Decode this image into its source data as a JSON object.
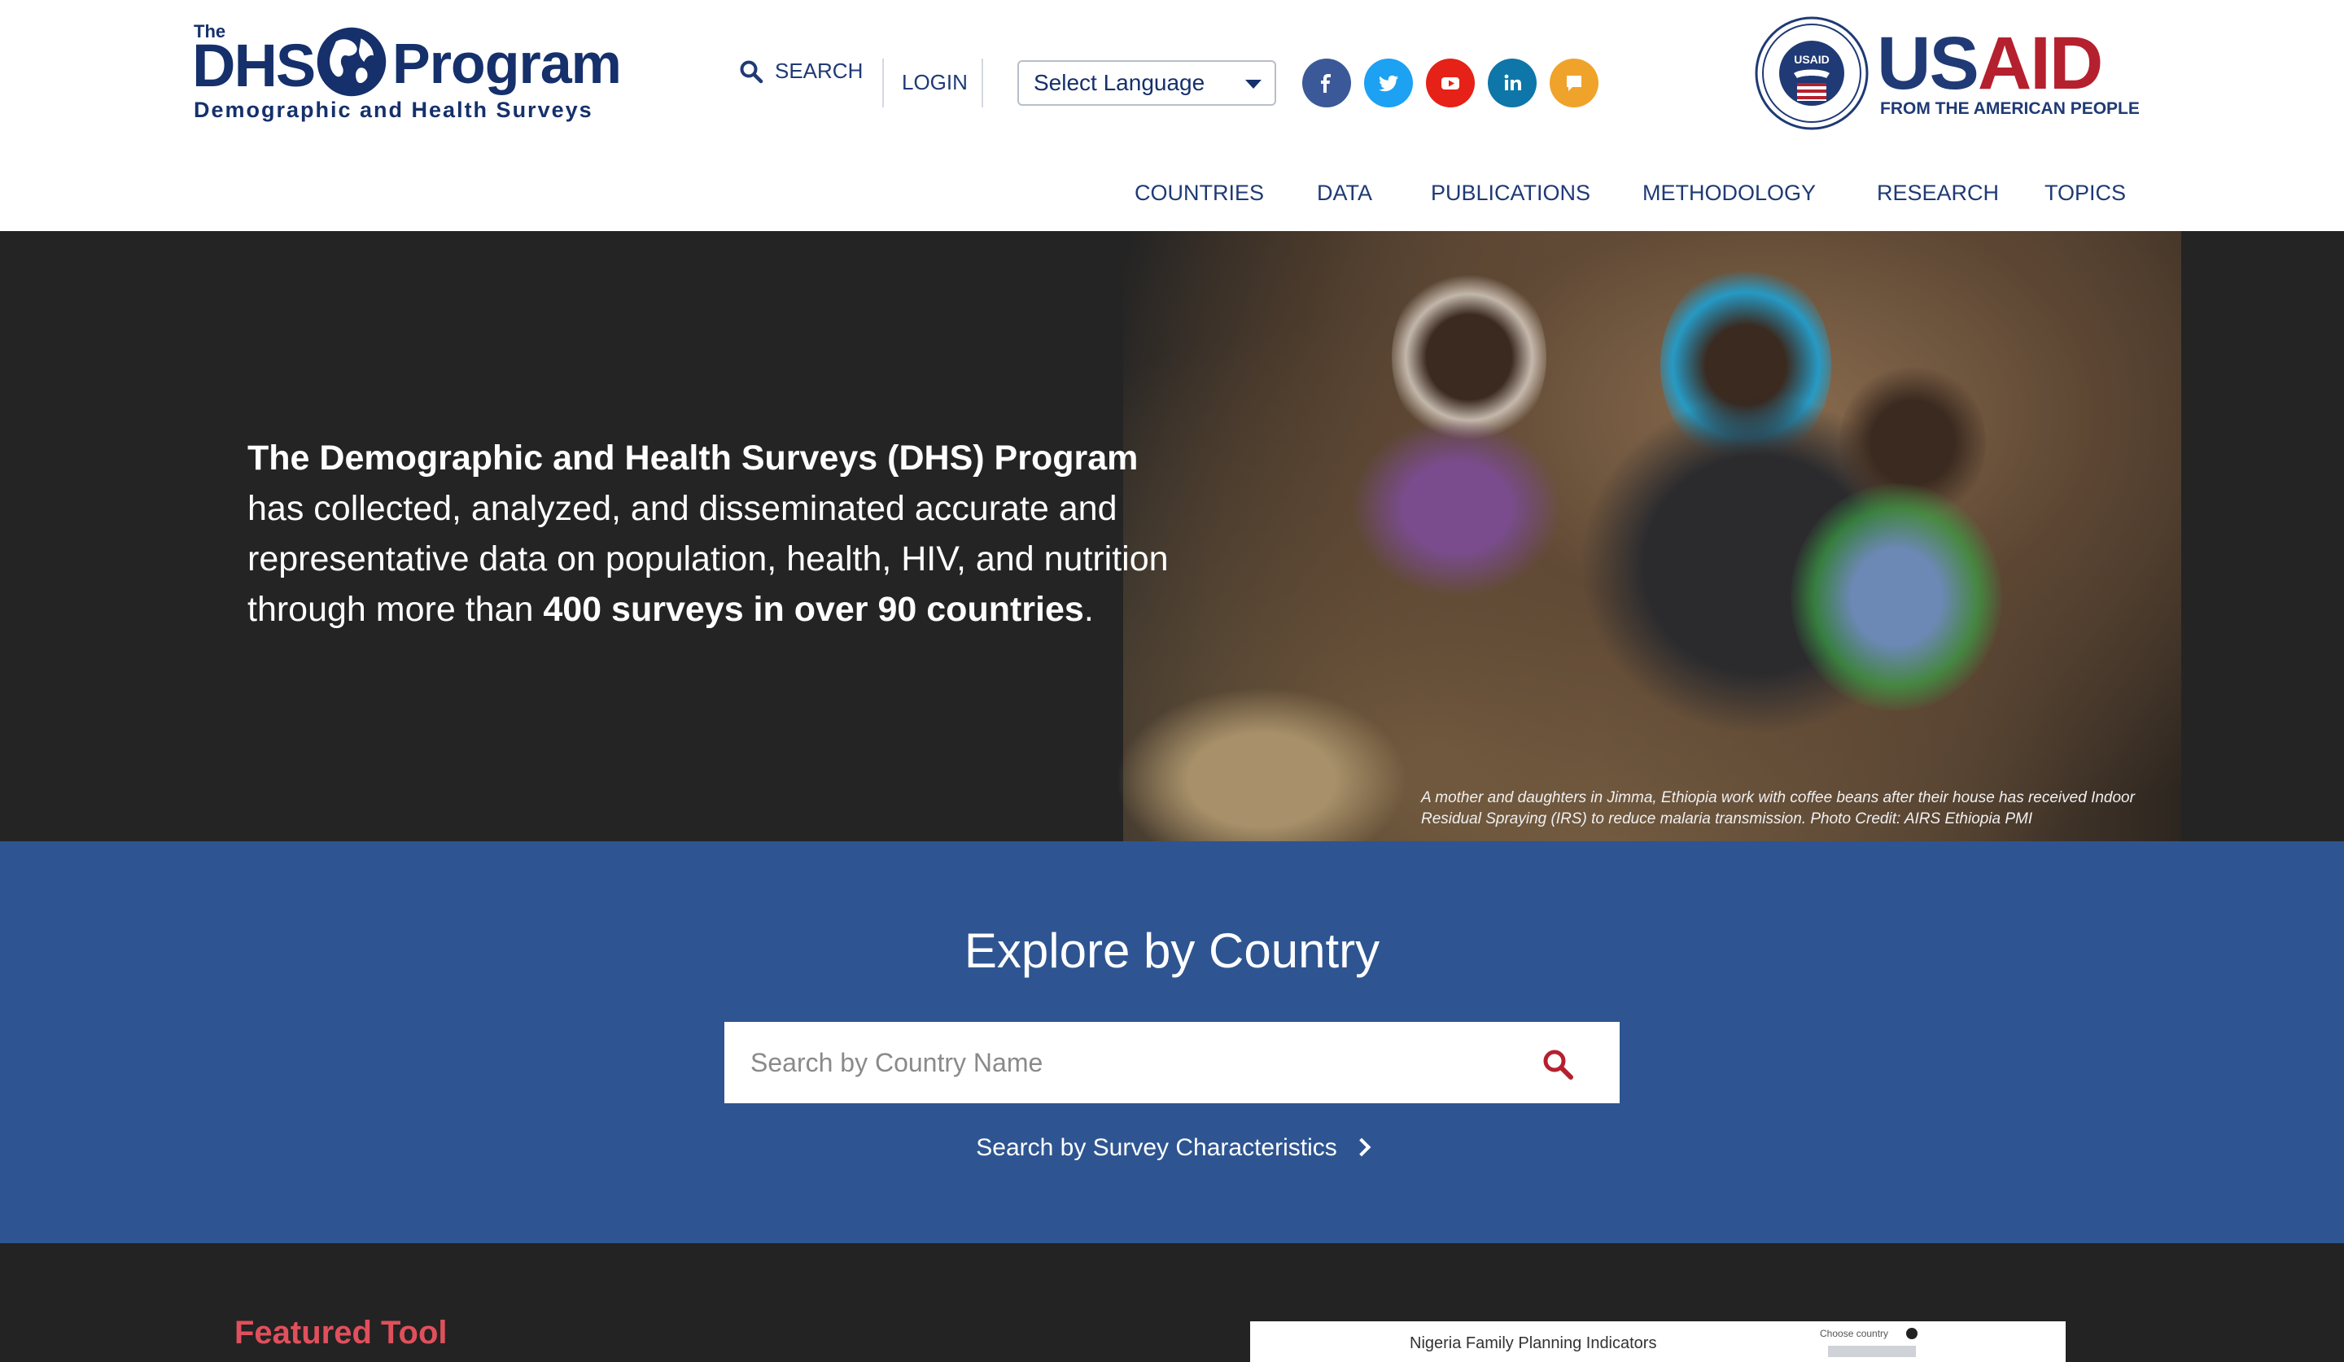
{
  "logo": {
    "the": "The",
    "dhs": "DHS",
    "program": "Program",
    "subtitle": "Demographic and Health Surveys"
  },
  "utility": {
    "search_label": "SEARCH",
    "login_label": "LOGIN",
    "language_select": "Select Language"
  },
  "social": [
    {
      "name": "facebook",
      "color": "#3b5998"
    },
    {
      "name": "twitter",
      "color": "#1da1f2"
    },
    {
      "name": "youtube",
      "color": "#e62117"
    },
    {
      "name": "linkedin",
      "color": "#0e76a8"
    },
    {
      "name": "comment",
      "color": "#f0a32a"
    }
  ],
  "usaid": {
    "us": "US",
    "aid": "AID",
    "tagline": "FROM THE AMERICAN PEOPLE",
    "seal_text": "USAID"
  },
  "nav": [
    "COUNTRIES",
    "DATA",
    "PUBLICATIONS",
    "METHODOLOGY",
    "RESEARCH",
    "TOPICS"
  ],
  "hero": {
    "lead_bold": "The Demographic and Health Surveys (DHS) Program",
    "lead_rest": " has collected, analyzed, and disseminated accurate and representative data on population, health, HIV, and nutrition through more than ",
    "stat_bold": "400 surveys in over 90 countries",
    "tail": ".",
    "caption": "A mother and daughters in Jimma, Ethiopia work with coffee beans after their house has received Indoor Residual Spraying (IRS) to reduce malaria transmission. Photo Credit: AIRS Ethiopia PMI"
  },
  "explore": {
    "heading": "Explore by Country",
    "search_placeholder": "Search by Country Name",
    "survey_link": "Search by Survey Characteristics"
  },
  "featured": {
    "heading": "Featured Tool",
    "preview_title": "Nigeria Family Planning Indicators",
    "preview_chooser": "Choose country"
  },
  "colors": {
    "brand_blue": "#15306b",
    "explore_bg": "#2e5591",
    "hero_bg": "#242424",
    "featured_red": "#e0505c",
    "usaid_red": "#b5202e"
  }
}
